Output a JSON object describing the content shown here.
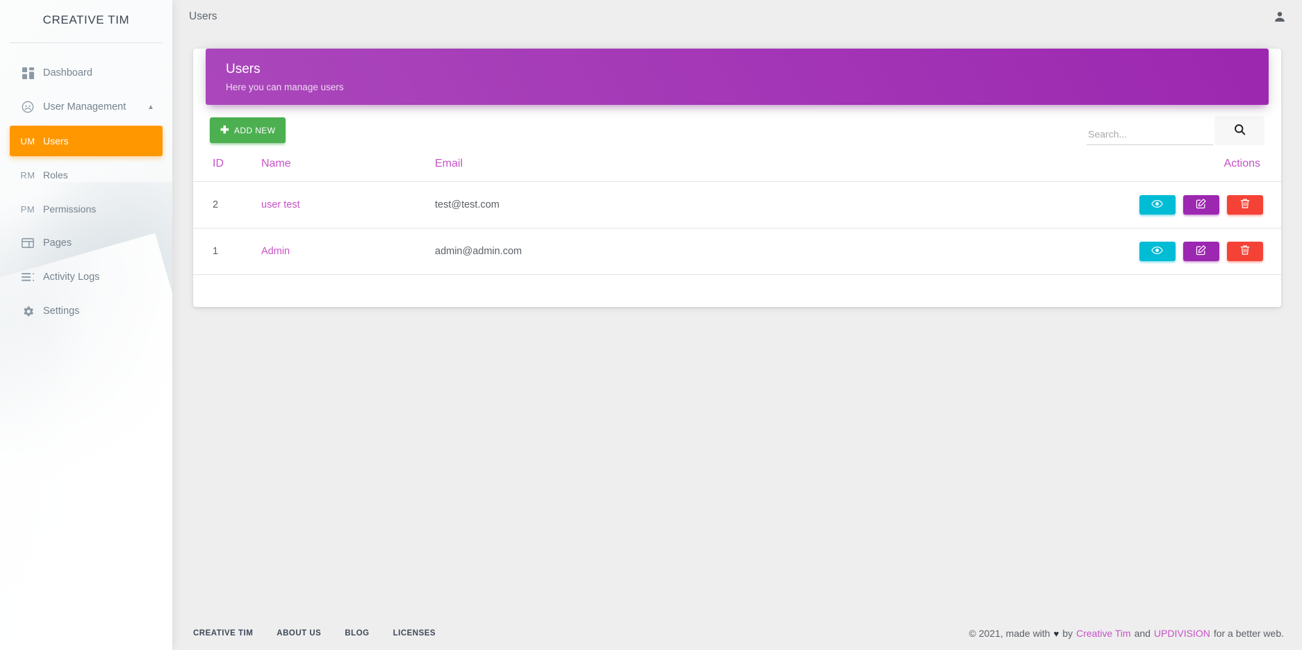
{
  "sidebar": {
    "brand": "CREATIVE TIM",
    "items": [
      {
        "label": "Dashboard",
        "icon": "dashboard-icon",
        "type": "icon",
        "active": false
      },
      {
        "label": "User Management",
        "icon": "user-circle-icon",
        "type": "icon",
        "active": false,
        "expanded": true,
        "chevron": "chevron-up-icon"
      },
      {
        "label": "Users",
        "abbr": "UM",
        "type": "abbr",
        "active": true
      },
      {
        "label": "Roles",
        "abbr": "RM",
        "type": "abbr",
        "active": false
      },
      {
        "label": "Permissions",
        "abbr": "PM",
        "type": "abbr",
        "active": false
      },
      {
        "label": "Pages",
        "icon": "pages-icon",
        "type": "icon",
        "active": false
      },
      {
        "label": "Activity Logs",
        "icon": "activity-logs-icon",
        "type": "icon",
        "active": false
      },
      {
        "label": "Settings",
        "icon": "gear-icon",
        "type": "icon",
        "active": false
      }
    ]
  },
  "topbar": {
    "breadcrumb": "Users",
    "user_icon": "person-icon"
  },
  "card": {
    "title": "Users",
    "subtitle": "Here you can manage users",
    "accent_color": "#9c27b0"
  },
  "toolbar": {
    "add_label": "ADD NEW",
    "add_icon": "plus-icon",
    "add_color": "#4caf50",
    "search_placeholder": "Search...",
    "search_value": "",
    "search_icon": "search-icon"
  },
  "table": {
    "columns": [
      "ID",
      "Name",
      "Email",
      "Actions"
    ],
    "rows": [
      {
        "id": "2",
        "name": "user test",
        "email": "test@test.com"
      },
      {
        "id": "1",
        "name": "Admin",
        "email": "admin@admin.com"
      }
    ],
    "actions": [
      {
        "name": "view",
        "icon": "eye-icon",
        "color": "#00bcd4"
      },
      {
        "name": "edit",
        "icon": "edit-pencil-icon",
        "color": "#9c27b0"
      },
      {
        "name": "delete",
        "icon": "trash-icon",
        "color": "#f44336"
      }
    ],
    "header_color": "#c653c6"
  },
  "footer": {
    "links": [
      "CREATIVE TIM",
      "ABOUT US",
      "BLOG",
      "LICENSES"
    ],
    "copyright_prefix": "© 2021, made with",
    "heart": "♥",
    "by": "by",
    "link1": "Creative Tim",
    "and": "and",
    "link2": "UPDIVISION",
    "suffix": "for a better web."
  }
}
